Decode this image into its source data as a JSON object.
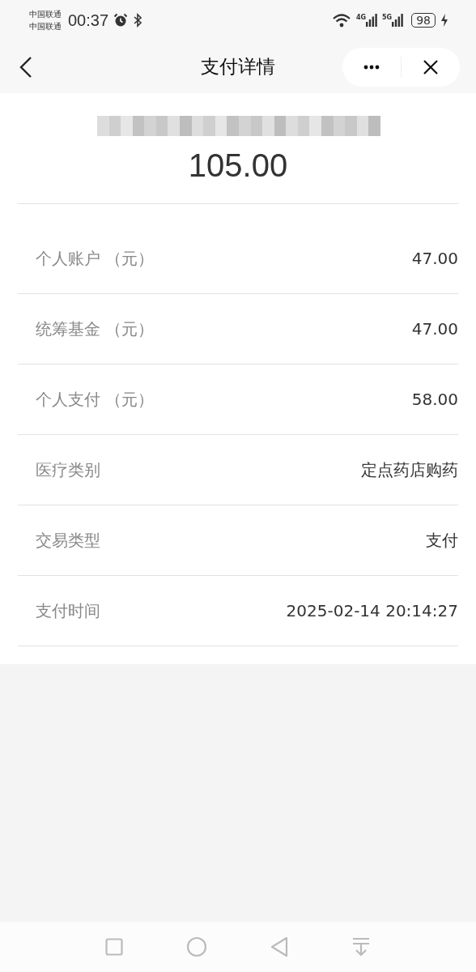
{
  "status_bar": {
    "carriers": [
      "中国联通",
      "中国联通"
    ],
    "time": "00:37",
    "signals": [
      "4G",
      "5G"
    ],
    "battery": "98"
  },
  "header": {
    "title": "支付详情"
  },
  "payment": {
    "amount": "105.00"
  },
  "details": [
    {
      "label": "个人账户 （元）",
      "value": "47.00"
    },
    {
      "label": "统筹基金 （元）",
      "value": "47.00"
    },
    {
      "label": "个人支付 （元）",
      "value": "58.00"
    },
    {
      "label": "医疗类别",
      "value": "定点药店购药"
    },
    {
      "label": "交易类型",
      "value": "支付"
    },
    {
      "label": "支付时间",
      "value": "2025-02-14 20:14:27"
    }
  ]
}
